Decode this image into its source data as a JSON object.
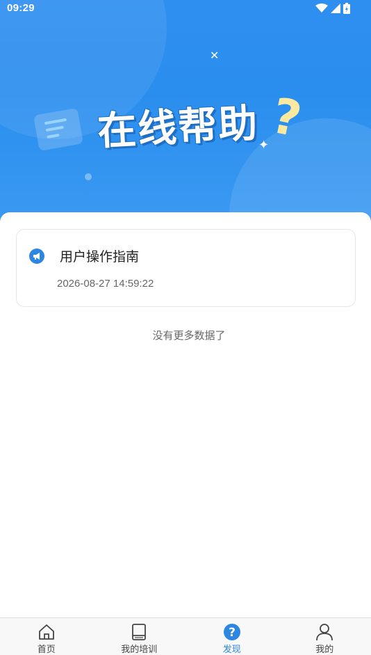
{
  "status_bar": {
    "time": "09:29"
  },
  "hero": {
    "title": "在线帮助",
    "question_mark": "?"
  },
  "help_list": {
    "items": [
      {
        "title": "用户操作指南",
        "date": "2026-08-27 14:59:22"
      }
    ],
    "end_text": "没有更多数据了"
  },
  "tabbar": {
    "tabs": [
      {
        "label": "首页",
        "icon": "home-icon"
      },
      {
        "label": "我的培训",
        "icon": "book-icon"
      },
      {
        "label": "发现",
        "icon": "help-circle-icon",
        "active": true
      },
      {
        "label": "我的",
        "icon": "person-icon"
      }
    ]
  },
  "colors": {
    "accent": "#2d86e2",
    "hero_bg": "#2f8ff0"
  }
}
